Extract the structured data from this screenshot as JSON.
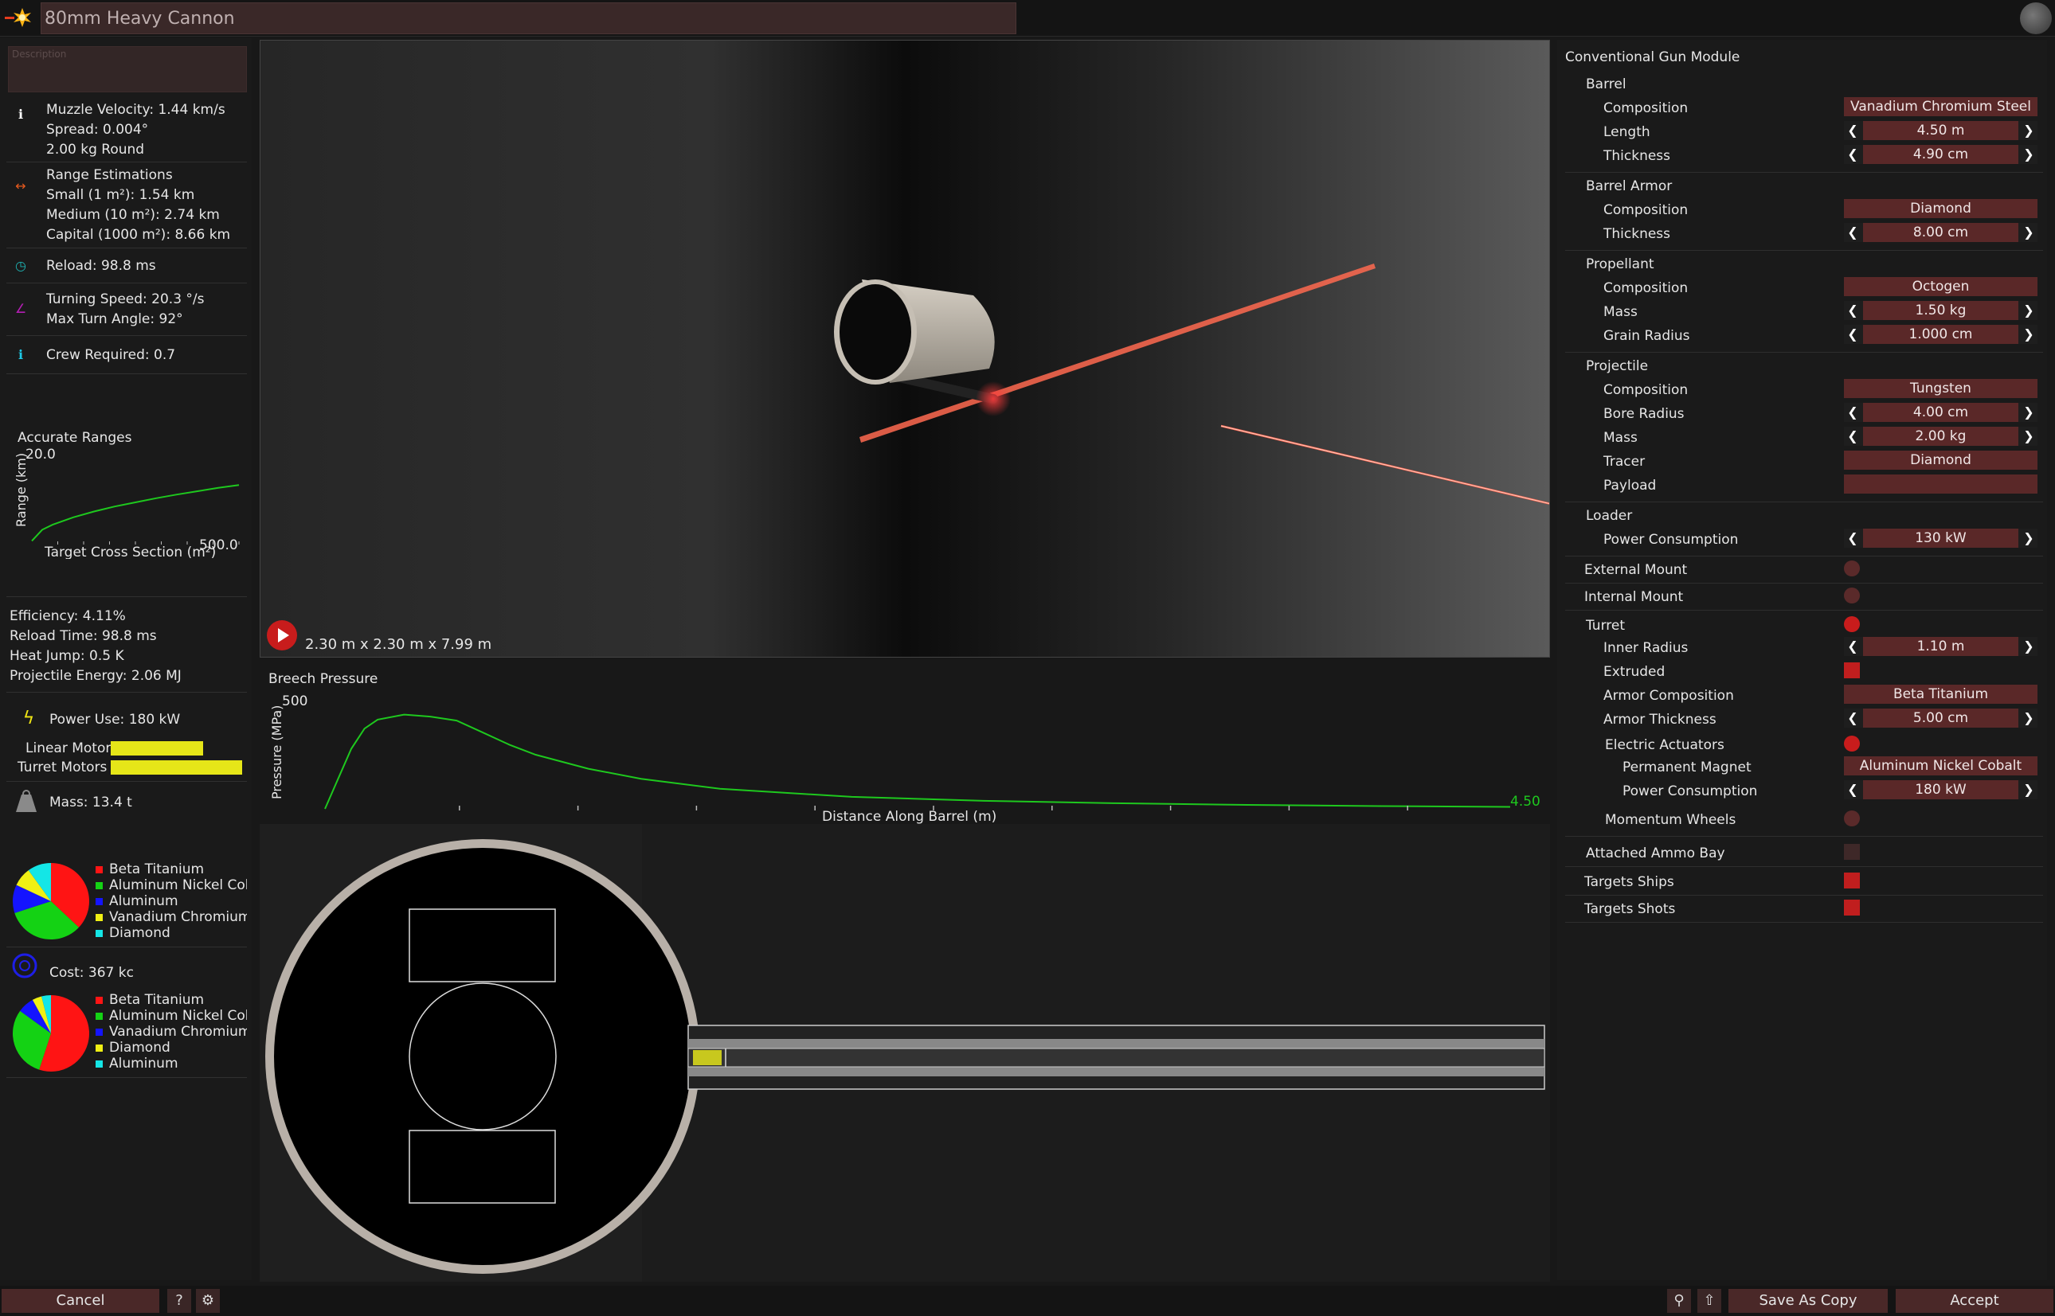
{
  "header": {
    "title": "80mm Heavy Cannon"
  },
  "description": {
    "placeholder": "Description"
  },
  "stats": {
    "ballistics": [
      "Muzzle Velocity: 1.44 km/s",
      "Spread: 0.004°",
      "2.00 kg Round"
    ],
    "range": [
      "Range Estimations",
      "Small (1 m²): 1.54 km",
      "Medium (10 m²): 2.74 km",
      "Capital (1000 m²): 8.66 km"
    ],
    "reload": "Reload: 98.8 ms",
    "turning": [
      "Turning Speed: 20.3 °/s",
      "Max Turn Angle: 92°"
    ],
    "crew": "Crew Required: 0.7",
    "efficiency": [
      "Efficiency: 4.11%",
      "Reload Time: 98.8 ms",
      "Heat Jump: 0.5 K",
      "Projectile Energy: 2.06 MJ"
    ],
    "power": "Power Use: 180 kW",
    "power_bars": [
      {
        "label": "Linear Motor",
        "fraction": 0.7
      },
      {
        "label": "Turret Motors",
        "fraction": 1.0
      }
    ],
    "mass": "Mass: 13.4 t",
    "cost": "Cost: 367 kc"
  },
  "accurate_ranges_chart": {
    "type": "line",
    "title": "Accurate Ranges",
    "xlabel": "Target Cross Section (m²)",
    "ylabel": "Range (km)",
    "xlim": [
      0,
      500.0
    ],
    "ylim": [
      0,
      20.0
    ],
    "ymax_label": "20.0",
    "xmax_label": "500.0",
    "x": [
      0,
      25,
      50,
      100,
      150,
      200,
      250,
      300,
      350,
      400,
      450,
      500
    ],
    "values": [
      0.5,
      3.2,
      4.4,
      6.2,
      7.6,
      8.8,
      9.8,
      10.8,
      11.7,
      12.5,
      13.3,
      14.0
    ]
  },
  "mass_chart": {
    "type": "pie",
    "labels": [
      "Beta Titanium",
      "Aluminum Nickel Cobalt",
      "Aluminum",
      "Vanadium Chromium Steel",
      "Diamond"
    ],
    "values": [
      37,
      33,
      12,
      8,
      10
    ],
    "colors": [
      "#ff1414",
      "#14d214",
      "#1414ff",
      "#f0f014",
      "#14e6e6"
    ]
  },
  "cost_chart": {
    "type": "pie",
    "labels": [
      "Beta Titanium",
      "Aluminum Nickel Cobalt",
      "Vanadium Chromium Steel",
      "Diamond",
      "Aluminum"
    ],
    "values": [
      55,
      30,
      7,
      4,
      4
    ],
    "colors": [
      "#ff1414",
      "#14d214",
      "#1414ff",
      "#f0f014",
      "#14e6e6"
    ]
  },
  "viewport": {
    "dimensions": "2.30 m x 2.30 m x 7.99 m"
  },
  "breech_chart": {
    "type": "line",
    "title": "Breech Pressure",
    "xlabel": "Distance Along Barrel (m)",
    "ylabel": "Pressure (MPa)",
    "xlim": [
      0,
      4.5
    ],
    "ylim": [
      0,
      500
    ],
    "ymax_label": "500",
    "xmax_label": "4.50",
    "x": [
      0.0,
      0.05,
      0.1,
      0.15,
      0.2,
      0.3,
      0.4,
      0.5,
      0.6,
      0.7,
      0.8,
      1.0,
      1.2,
      1.5,
      2.0,
      2.5,
      3.0,
      3.5,
      4.0,
      4.5
    ],
    "values": [
      0,
      150,
      300,
      400,
      445,
      470,
      460,
      440,
      380,
      320,
      270,
      200,
      150,
      100,
      60,
      40,
      28,
      20,
      14,
      10
    ]
  },
  "module": {
    "title": "Conventional Gun Module",
    "sections": {
      "barrel": "Barrel",
      "barrel_armor": "Barrel Armor",
      "propellant": "Propellant",
      "projectile": "Projectile",
      "loader": "Loader"
    },
    "barrel": {
      "composition_label": "Composition",
      "composition": "Vanadium Chromium Steel",
      "length_label": "Length",
      "length": "4.50 m",
      "thickness_label": "Thickness",
      "thickness": "4.90 cm"
    },
    "barrel_armor": {
      "composition_label": "Composition",
      "composition": "Diamond",
      "thickness_label": "Thickness",
      "thickness": "8.00 cm"
    },
    "propellant": {
      "composition_label": "Composition",
      "composition": "Octogen",
      "mass_label": "Mass",
      "mass": "1.50 kg",
      "grain_label": "Grain Radius",
      "grain": "1.000 cm"
    },
    "projectile": {
      "composition_label": "Composition",
      "composition": "Tungsten",
      "bore_label": "Bore Radius",
      "bore": "4.00 cm",
      "mass_label": "Mass",
      "mass": "2.00 kg",
      "tracer_label": "Tracer",
      "tracer": "Diamond",
      "payload_label": "Payload",
      "payload": ""
    },
    "loader": {
      "power_label": "Power Consumption",
      "power": "130 kW"
    },
    "external_mount": "External Mount",
    "internal_mount": "Internal Mount",
    "turret": {
      "label": "Turret",
      "inner_radius_label": "Inner Radius",
      "inner_radius": "1.10 m",
      "extruded_label": "Extruded",
      "armor_comp_label": "Armor Composition",
      "armor_comp": "Beta Titanium",
      "armor_thick_label": "Armor Thickness",
      "armor_thick": "5.00 cm",
      "actuators_label": "Electric Actuators",
      "magnet_label": "Permanent Magnet",
      "magnet": "Aluminum Nickel Cobalt",
      "act_power_label": "Power Consumption",
      "act_power": "180 kW",
      "momentum_label": "Momentum Wheels"
    },
    "ammo_bay": "Attached Ammo Bay",
    "targets_ships": "Targets Ships",
    "targets_shots": "Targets Shots"
  },
  "footer": {
    "cancel": "Cancel",
    "help": "?",
    "save_copy": "Save As Copy",
    "accept": "Accept"
  }
}
